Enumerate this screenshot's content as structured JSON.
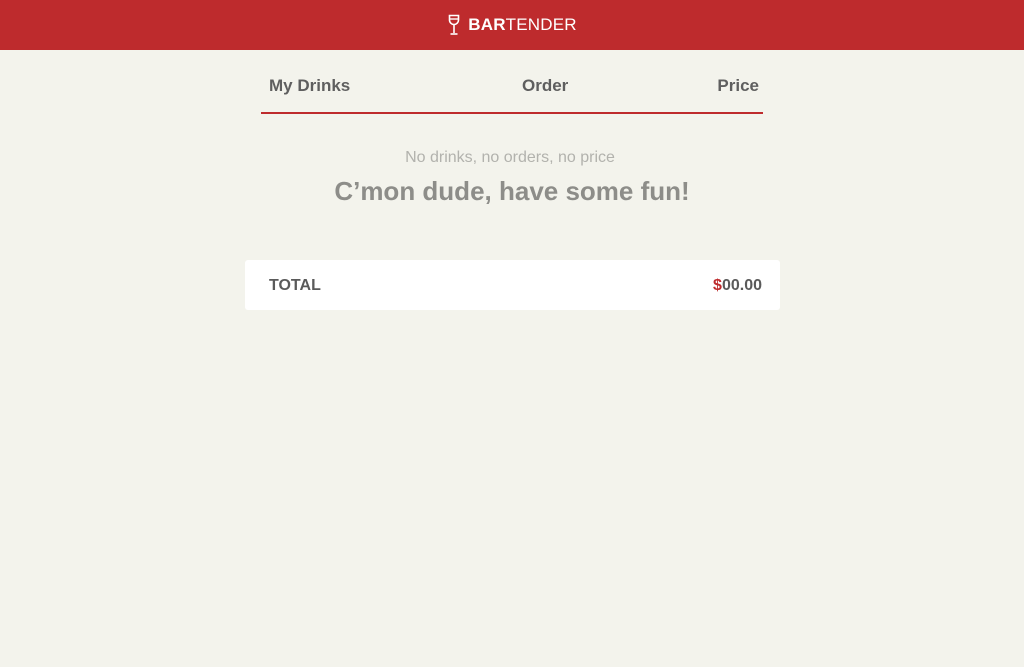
{
  "header": {
    "brand_bold": "BAR",
    "brand_light": "TENDER",
    "logo_icon": "wine-glass-icon",
    "background_color": "#be2b2d"
  },
  "tabs": [
    {
      "label": "My Drinks"
    },
    {
      "label": "Order"
    },
    {
      "label": "Price"
    }
  ],
  "empty_state": {
    "subtitle": "No drinks, no orders, no price",
    "message": "C’mon dude, have some fun!"
  },
  "total": {
    "label": "TOTAL",
    "currency": "$",
    "amount": "00.00",
    "currency_color": "#be2b2d"
  }
}
